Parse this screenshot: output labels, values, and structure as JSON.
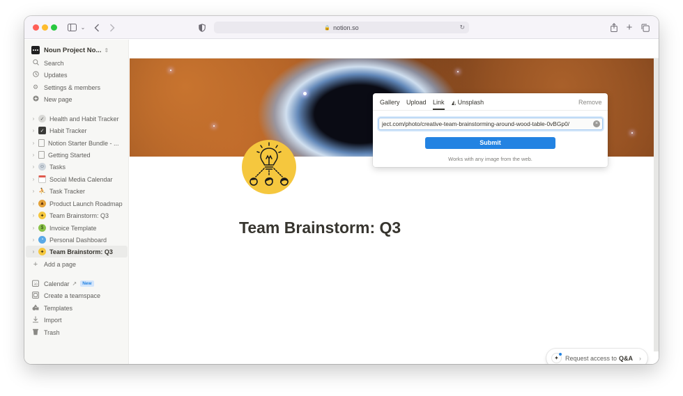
{
  "browser": {
    "url": "notion.so"
  },
  "sidebar": {
    "workspace": "Noun Project No...",
    "nav": [
      {
        "label": "Search",
        "icon": "search-icon"
      },
      {
        "label": "Updates",
        "icon": "clock-icon"
      },
      {
        "label": "Settings & members",
        "icon": "gear-icon"
      },
      {
        "label": "New page",
        "icon": "plus-circle-icon"
      }
    ],
    "pages": [
      {
        "label": "Health and Habit Tracker",
        "icon": "checklist-icon"
      },
      {
        "label": "Habit Tracker",
        "icon": "checkbox-icon"
      },
      {
        "label": "Notion Starter Bundle - ...",
        "icon": "document-icon"
      },
      {
        "label": "Getting Started",
        "icon": "document-icon"
      },
      {
        "label": "Tasks",
        "icon": "tasks-icon"
      },
      {
        "label": "Social Media Calendar",
        "icon": "calendar-page-icon"
      },
      {
        "label": "Task Tracker",
        "icon": "people-icon"
      },
      {
        "label": "Product Launch Roadmap",
        "icon": "rocket-icon"
      },
      {
        "label": "Team Brainstorm: Q3",
        "icon": "lightbulb-icon"
      },
      {
        "label": "Invoice Template",
        "icon": "invoice-icon"
      },
      {
        "label": "Personal Dashboard",
        "icon": "dashboard-icon"
      },
      {
        "label": "Team Brainstorm: Q3",
        "icon": "lightbulb-icon"
      }
    ],
    "add_page": "Add a page",
    "tools": [
      {
        "label": "Calendar",
        "icon": "calendar-icon",
        "badge": "New"
      },
      {
        "label": "Create a teamspace",
        "icon": "teamspace-icon"
      },
      {
        "label": "Templates",
        "icon": "templates-icon"
      },
      {
        "label": "Import",
        "icon": "import-icon"
      },
      {
        "label": "Trash",
        "icon": "trash-icon"
      }
    ]
  },
  "page": {
    "title": "Team Brainstorm: Q3"
  },
  "cover_popup": {
    "tabs": [
      "Gallery",
      "Upload",
      "Link",
      "Unsplash"
    ],
    "active_tab": "Link",
    "remove_label": "Remove",
    "input_value": "ject.com/photo/creative-team-brainstorming-around-wood-table-0vBGp0/",
    "submit_label": "Submit",
    "hint": "Works with any image from the web."
  },
  "qa_button": {
    "label_prefix": "Request access to",
    "label_emphasis": "Q&A"
  },
  "colors": {
    "accent": "#2383e2",
    "icon_bg": "#f5c73e",
    "sidebar_bg": "#f7f7f5"
  }
}
